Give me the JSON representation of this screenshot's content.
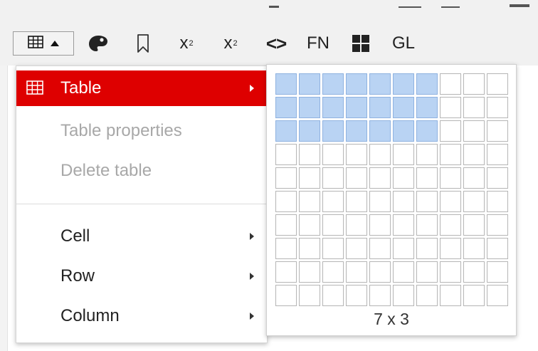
{
  "toolbar": {
    "table_button": {
      "icon": "table-grid-icon"
    },
    "buttons": [
      {
        "name": "palette-icon"
      },
      {
        "name": "bookmark-icon"
      },
      {
        "name": "superscript-button",
        "text": "x",
        "mark": "2"
      },
      {
        "name": "subscript-button",
        "text": "x",
        "mark": "2"
      },
      {
        "name": "code-button",
        "text": "<>"
      },
      {
        "name": "footnote-button",
        "text": "FN"
      },
      {
        "name": "grid-blocks-icon"
      },
      {
        "name": "glossary-button",
        "text": "GL"
      }
    ]
  },
  "menu": {
    "items": [
      {
        "label": "Table",
        "state": "active",
        "submenu": true
      },
      {
        "label": "Table properties",
        "state": "disabled",
        "submenu": false
      },
      {
        "label": "Delete table",
        "state": "disabled",
        "submenu": false
      },
      {
        "label": "Cell",
        "state": "normal",
        "submenu": true
      },
      {
        "label": "Row",
        "state": "normal",
        "submenu": true
      },
      {
        "label": "Column",
        "state": "normal",
        "submenu": true
      }
    ]
  },
  "picker": {
    "columns": 10,
    "rows": 10,
    "selected_cols": 7,
    "selected_rows": 3,
    "size_label": "7 x 3"
  },
  "colors": {
    "accent": "#de0000",
    "selected_cell": "#b9d3f3"
  }
}
